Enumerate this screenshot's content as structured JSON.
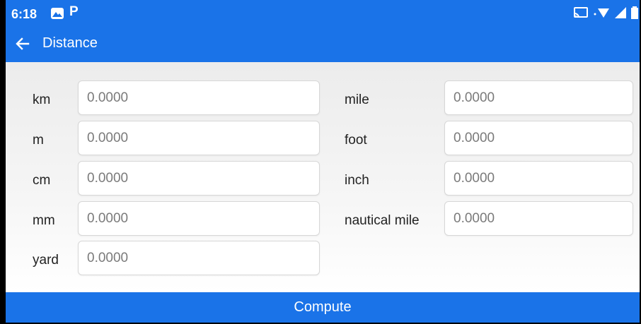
{
  "status_bar": {
    "time": "6:18",
    "left_icons": [
      "photo-icon",
      "parking-icon"
    ],
    "right_icons": [
      "cast-icon",
      "wifi-icon",
      "signal-icon",
      "battery-icon"
    ]
  },
  "toolbar": {
    "title": "Distance",
    "back_icon": "arrow-left-icon"
  },
  "units_left": [
    {
      "label": "km",
      "placeholder": "0.0000"
    },
    {
      "label": "m",
      "placeholder": "0.0000"
    },
    {
      "label": "cm",
      "placeholder": "0.0000"
    },
    {
      "label": "mm",
      "placeholder": "0.0000"
    },
    {
      "label": "yard",
      "placeholder": "0.0000"
    }
  ],
  "units_right": [
    {
      "label": "mile",
      "placeholder": "0.0000"
    },
    {
      "label": "foot",
      "placeholder": "0.0000"
    },
    {
      "label": "inch",
      "placeholder": "0.0000"
    },
    {
      "label": "nautical mile",
      "placeholder": "0.0000"
    }
  ],
  "compute_button": {
    "label": "Compute"
  },
  "colors": {
    "primary": "#1a73e8",
    "background": "#efefef"
  }
}
